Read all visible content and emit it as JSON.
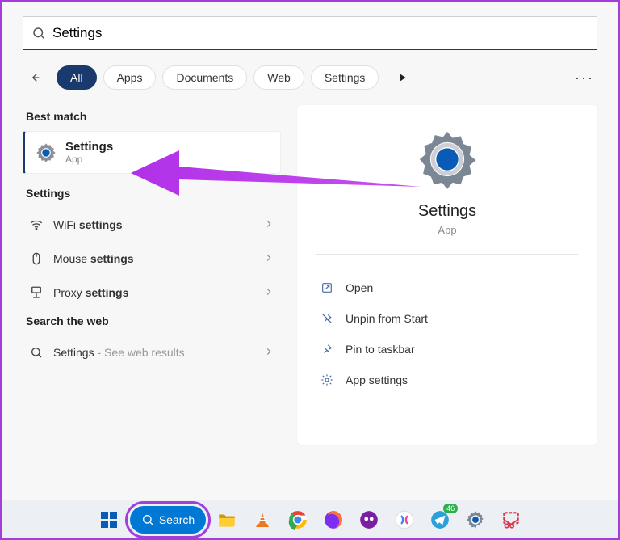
{
  "search": {
    "value": "Settings"
  },
  "tabs": {
    "all": "All",
    "apps": "Apps",
    "documents": "Documents",
    "web": "Web",
    "settings": "Settings"
  },
  "left": {
    "bestMatchLabel": "Best match",
    "bestMatch": {
      "title": "Settings",
      "sub": "App"
    },
    "settingsLabel": "Settings",
    "rows": {
      "wifi": {
        "prefix": "WiFi ",
        "bold": "settings"
      },
      "mouse": {
        "prefix": "Mouse ",
        "bold": "settings"
      },
      "proxy": {
        "prefix": "Proxy ",
        "bold": "settings"
      }
    },
    "webLabel": "Search the web",
    "webRow": {
      "title": "Settings",
      "suffix": " - See web results"
    }
  },
  "detail": {
    "title": "Settings",
    "sub": "App",
    "actions": {
      "open": "Open",
      "unpin": "Unpin from Start",
      "pin": "Pin to taskbar",
      "appSettings": "App settings"
    }
  },
  "taskbar": {
    "searchLabel": "Search",
    "telegramBadge": "46"
  }
}
